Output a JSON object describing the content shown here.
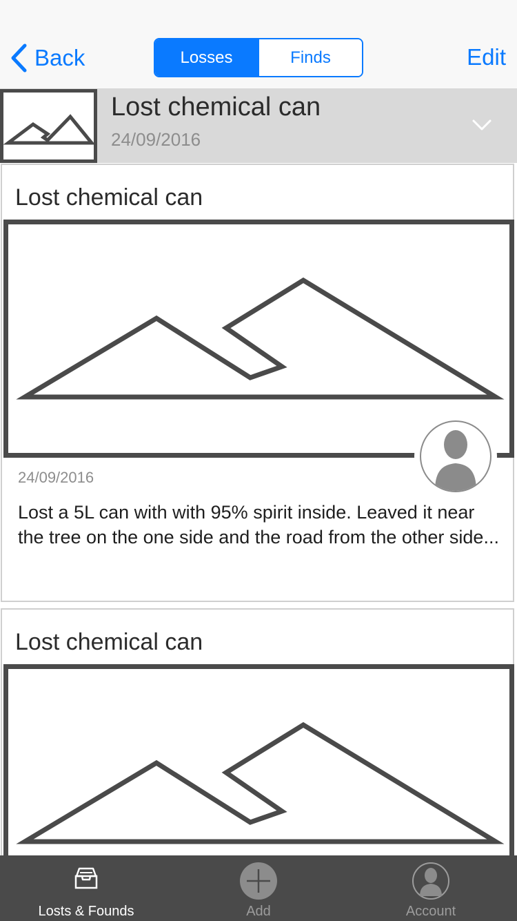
{
  "nav": {
    "back_label": "Back",
    "segments": [
      "Losses",
      "Finds"
    ],
    "active_segment": "Losses",
    "edit_label": "Edit",
    "accent_color": "#0a7aff"
  },
  "summary": {
    "title": "Lost chemical can",
    "date": "24/09/2016",
    "expand_icon": "chevron-down-icon"
  },
  "cards": [
    {
      "title": "Lost chemical can",
      "image_icon": "image-placeholder-icon",
      "avatar_icon": "user-avatar-icon",
      "date": "24/09/2016",
      "description": "Lost a 5L can with with 95% spirit inside. Leaved it near the tree on the one side and the road from the other side..."
    },
    {
      "title": "Lost chemical can",
      "image_icon": "image-placeholder-icon"
    }
  ],
  "tabbar": {
    "tabs": [
      {
        "label": "Losts & Founds",
        "icon": "inbox-tray-icon",
        "active": true
      },
      {
        "label": "Add",
        "icon": "plus-circle-icon",
        "active": false
      },
      {
        "label": "Account",
        "icon": "account-icon",
        "active": false
      }
    ]
  }
}
